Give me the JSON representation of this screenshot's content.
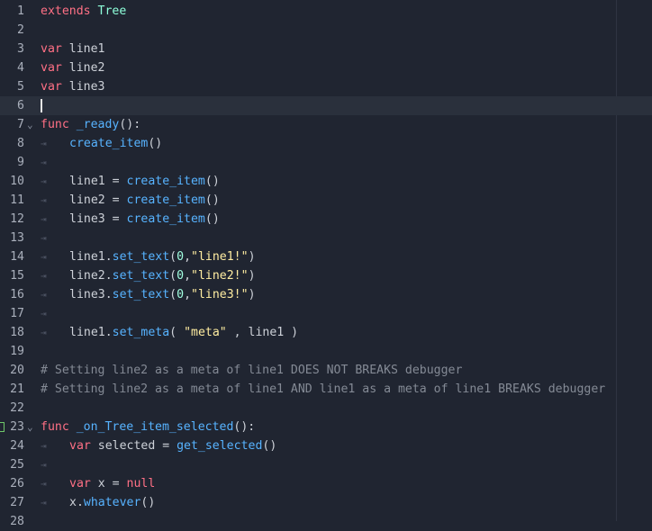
{
  "editor": {
    "lines": [
      {
        "n": "1",
        "fold": "",
        "tokens": [
          {
            "t": "extends",
            "c": "kw"
          },
          {
            "t": " "
          },
          {
            "t": "Tree",
            "c": "cls"
          }
        ]
      },
      {
        "n": "2",
        "fold": "",
        "tokens": []
      },
      {
        "n": "3",
        "fold": "",
        "tokens": [
          {
            "t": "var",
            "c": "kw"
          },
          {
            "t": " line1"
          }
        ]
      },
      {
        "n": "4",
        "fold": "",
        "tokens": [
          {
            "t": "var",
            "c": "kw"
          },
          {
            "t": " line2"
          }
        ]
      },
      {
        "n": "5",
        "fold": "",
        "tokens": [
          {
            "t": "var",
            "c": "kw"
          },
          {
            "t": " line3"
          }
        ]
      },
      {
        "n": "6",
        "fold": "",
        "current": true,
        "tokens": []
      },
      {
        "n": "7",
        "fold": "⌄",
        "tokens": [
          {
            "t": "func",
            "c": "kw"
          },
          {
            "t": " "
          },
          {
            "t": "_ready",
            "c": "fn"
          },
          {
            "t": "():"
          }
        ]
      },
      {
        "n": "8",
        "fold": "",
        "tokens": [
          {
            "tab": true
          },
          {
            "t": "create_item",
            "c": "fn"
          },
          {
            "t": "()"
          }
        ]
      },
      {
        "n": "9",
        "fold": "",
        "tokens": [
          {
            "tab": true
          }
        ]
      },
      {
        "n": "10",
        "fold": "",
        "tokens": [
          {
            "tab": true
          },
          {
            "t": "line1 = "
          },
          {
            "t": "create_item",
            "c": "fn"
          },
          {
            "t": "()"
          }
        ]
      },
      {
        "n": "11",
        "fold": "",
        "tokens": [
          {
            "tab": true
          },
          {
            "t": "line2 = "
          },
          {
            "t": "create_item",
            "c": "fn"
          },
          {
            "t": "()"
          }
        ]
      },
      {
        "n": "12",
        "fold": "",
        "tokens": [
          {
            "tab": true
          },
          {
            "t": "line3 = "
          },
          {
            "t": "create_item",
            "c": "fn"
          },
          {
            "t": "()"
          }
        ]
      },
      {
        "n": "13",
        "fold": "",
        "tokens": [
          {
            "tab": true
          }
        ]
      },
      {
        "n": "14",
        "fold": "",
        "tokens": [
          {
            "tab": true
          },
          {
            "t": "line1."
          },
          {
            "t": "set_text",
            "c": "fn"
          },
          {
            "t": "("
          },
          {
            "t": "0",
            "c": "num-lit"
          },
          {
            "t": ","
          },
          {
            "t": "\"line1!\"",
            "c": "str"
          },
          {
            "t": ")"
          }
        ]
      },
      {
        "n": "15",
        "fold": "",
        "tokens": [
          {
            "tab": true
          },
          {
            "t": "line2."
          },
          {
            "t": "set_text",
            "c": "fn"
          },
          {
            "t": "("
          },
          {
            "t": "0",
            "c": "num-lit"
          },
          {
            "t": ","
          },
          {
            "t": "\"line2!\"",
            "c": "str"
          },
          {
            "t": ")"
          }
        ]
      },
      {
        "n": "16",
        "fold": "",
        "tokens": [
          {
            "tab": true
          },
          {
            "t": "line3."
          },
          {
            "t": "set_text",
            "c": "fn"
          },
          {
            "t": "("
          },
          {
            "t": "0",
            "c": "num-lit"
          },
          {
            "t": ","
          },
          {
            "t": "\"line3!\"",
            "c": "str"
          },
          {
            "t": ")"
          }
        ]
      },
      {
        "n": "17",
        "fold": "",
        "tokens": [
          {
            "tab": true
          }
        ]
      },
      {
        "n": "18",
        "fold": "",
        "tokens": [
          {
            "tab": true
          },
          {
            "t": "line1."
          },
          {
            "t": "set_meta",
            "c": "fn"
          },
          {
            "t": "( "
          },
          {
            "t": "\"meta\"",
            "c": "str"
          },
          {
            "t": " , line1 )"
          }
        ]
      },
      {
        "n": "19",
        "fold": "",
        "tokens": []
      },
      {
        "n": "20",
        "fold": "",
        "tokens": [
          {
            "t": "# Setting line2 as a meta of line1 DOES NOT BREAKS debugger",
            "c": "cm"
          }
        ]
      },
      {
        "n": "21",
        "fold": "",
        "tokens": [
          {
            "t": "# Setting line2 as a meta of line1 AND line1 as a meta of line1 BREAKS debugger",
            "c": "cm"
          }
        ]
      },
      {
        "n": "22",
        "fold": "",
        "tokens": []
      },
      {
        "n": "23",
        "fold": "⌄",
        "marker": true,
        "tokens": [
          {
            "t": "func",
            "c": "kw"
          },
          {
            "t": " "
          },
          {
            "t": "_on_Tree_item_selected",
            "c": "fn"
          },
          {
            "t": "():"
          }
        ]
      },
      {
        "n": "24",
        "fold": "",
        "tokens": [
          {
            "tab": true
          },
          {
            "t": "var",
            "c": "kw"
          },
          {
            "t": " selected = "
          },
          {
            "t": "get_selected",
            "c": "fn"
          },
          {
            "t": "()"
          }
        ]
      },
      {
        "n": "25",
        "fold": "",
        "tokens": [
          {
            "tab": true
          }
        ]
      },
      {
        "n": "26",
        "fold": "",
        "tokens": [
          {
            "tab": true
          },
          {
            "t": "var",
            "c": "kw"
          },
          {
            "t": " x = "
          },
          {
            "t": "null",
            "c": "kw"
          }
        ]
      },
      {
        "n": "27",
        "fold": "",
        "tokens": [
          {
            "tab": true
          },
          {
            "t": "x."
          },
          {
            "t": "whatever",
            "c": "fn"
          },
          {
            "t": "()"
          }
        ]
      },
      {
        "n": "28",
        "fold": "",
        "tokens": []
      }
    ]
  }
}
